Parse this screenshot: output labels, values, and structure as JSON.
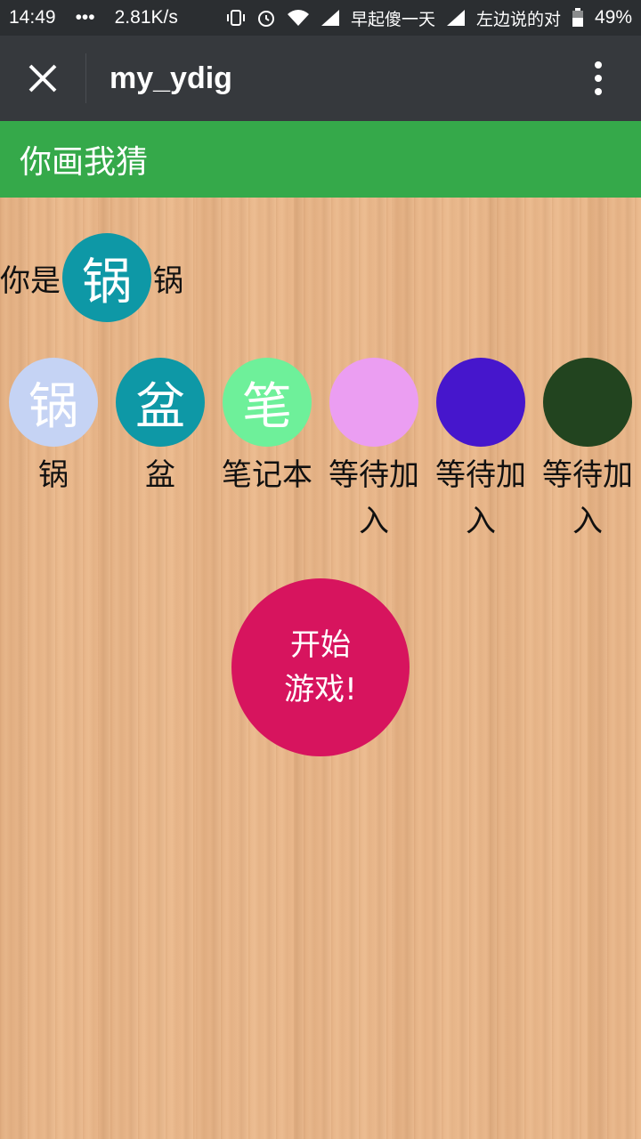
{
  "status_bar": {
    "time": "14:49",
    "dots": "•••",
    "speed": "2.81K/s",
    "carrier1": "早起傻一天",
    "carrier2": "左边说的对",
    "battery": "49%",
    "icons": [
      "vibrate-icon",
      "alarm-icon",
      "wifi-icon",
      "signal-icon",
      "battery-icon"
    ]
  },
  "title_bar": {
    "close_icon": "close-icon",
    "page_name": "my_ydig",
    "more_icon": "more-vertical-icon"
  },
  "header": {
    "title": "你画我猜"
  },
  "you": {
    "label": "你是",
    "avatar_char": "锅",
    "name": "锅",
    "avatar_color": "#0e98a6"
  },
  "players": [
    {
      "avatar_char": "锅",
      "name": "锅",
      "color": "#c5d3f4"
    },
    {
      "avatar_char": "盆",
      "name": "盆",
      "color": "#0e98a6"
    },
    {
      "avatar_char": "笔",
      "name": "笔记本",
      "color": "#6ef09a"
    },
    {
      "avatar_char": "",
      "name": "等待加入",
      "color": "#eb9ef2"
    },
    {
      "avatar_char": "",
      "name": "等待加入",
      "color": "#4616cc"
    },
    {
      "avatar_char": "",
      "name": "等待加入",
      "color": "#22441f"
    }
  ],
  "start_button": {
    "line1": "开始",
    "line2": "游戏!",
    "color": "#d7145e"
  },
  "colors": {
    "status_bar": "#2b2e31",
    "title_bar": "#36393d",
    "header": "#35a94a",
    "wood": "#e9b78b"
  }
}
